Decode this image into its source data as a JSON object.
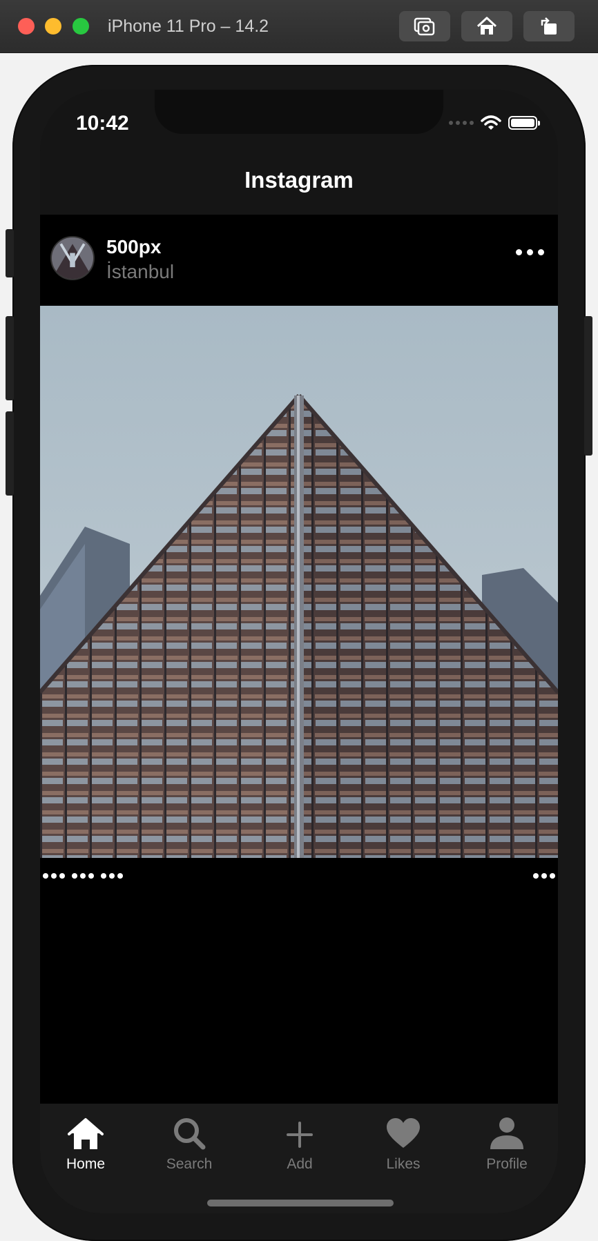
{
  "simulator": {
    "title": "iPhone 11 Pro – 14.2",
    "buttons": [
      {
        "icon": "screenshot-icon"
      },
      {
        "icon": "home-icon"
      },
      {
        "icon": "rotate-icon"
      }
    ]
  },
  "status_bar": {
    "time": "10:42",
    "battery_level": 1.0
  },
  "nav": {
    "title": "Instagram"
  },
  "post": {
    "username": "500px",
    "location": "İstanbul",
    "more_icon": "ellipsis-icon",
    "image_description_icon": "photo"
  },
  "tabs": [
    {
      "label": "Home",
      "icon": "home-icon",
      "active": true
    },
    {
      "label": "Search",
      "icon": "search-icon",
      "active": false
    },
    {
      "label": "Add",
      "icon": "plus-icon",
      "active": false
    },
    {
      "label": "Likes",
      "icon": "heart-icon",
      "active": false
    },
    {
      "label": "Profile",
      "icon": "person-icon",
      "active": false
    }
  ],
  "colors": {
    "background": "#151515",
    "post_background": "#000000",
    "tab_active": "#ffffff",
    "tab_inactive": "#7b7b7b"
  }
}
